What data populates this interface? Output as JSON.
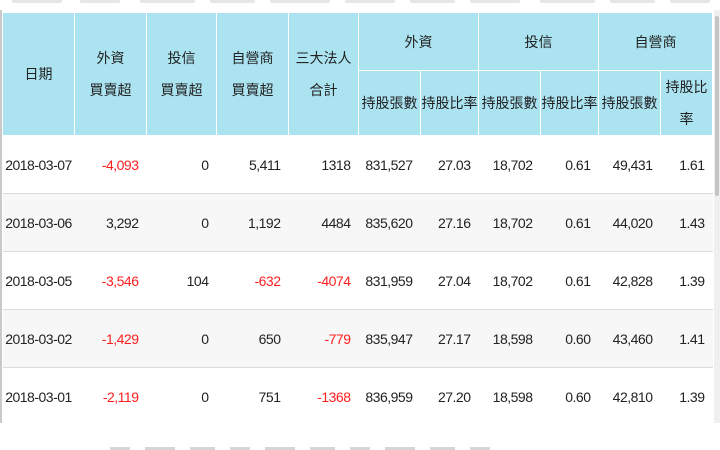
{
  "table": {
    "headers": {
      "date": "日期",
      "foreign_net_l1": "外資",
      "foreign_net_l2": "買賣超",
      "trust_net_l1": "投信",
      "trust_net_l2": "買賣超",
      "dealer_net_l1": "自營商",
      "dealer_net_l2": "買賣超",
      "total_l1": "三大法人",
      "total_l2": "合計",
      "foreign_group": "外資",
      "trust_group": "投信",
      "dealer_group": "自營商",
      "shares_held": "持股張數",
      "holding_ratio": "持股比率"
    },
    "rows": [
      {
        "date": "2018-03-07",
        "foreign_net": "-4,093",
        "trust_net": "0",
        "dealer_net": "5,411",
        "total": "1318",
        "f_shares": "831,527",
        "f_ratio": "27.03",
        "t_shares": "18,702",
        "t_ratio": "0.61",
        "d_shares": "49,431",
        "d_ratio": "1.61"
      },
      {
        "date": "2018-03-06",
        "foreign_net": "3,292",
        "trust_net": "0",
        "dealer_net": "1,192",
        "total": "4484",
        "f_shares": "835,620",
        "f_ratio": "27.16",
        "t_shares": "18,702",
        "t_ratio": "0.61",
        "d_shares": "44,020",
        "d_ratio": "1.43"
      },
      {
        "date": "2018-03-05",
        "foreign_net": "-3,546",
        "trust_net": "104",
        "dealer_net": "-632",
        "total": "-4074",
        "f_shares": "831,959",
        "f_ratio": "27.04",
        "t_shares": "18,702",
        "t_ratio": "0.61",
        "d_shares": "42,828",
        "d_ratio": "1.39"
      },
      {
        "date": "2018-03-02",
        "foreign_net": "-1,429",
        "trust_net": "0",
        "dealer_net": "650",
        "total": "-779",
        "f_shares": "835,947",
        "f_ratio": "27.17",
        "t_shares": "18,598",
        "t_ratio": "0.60",
        "d_shares": "43,460",
        "d_ratio": "1.41"
      },
      {
        "date": "2018-03-01",
        "foreign_net": "-2,119",
        "trust_net": "0",
        "dealer_net": "751",
        "total": "-1368",
        "f_shares": "836,959",
        "f_ratio": "27.20",
        "t_shares": "18,598",
        "t_ratio": "0.60",
        "d_shares": "42,810",
        "d_ratio": "1.39"
      }
    ]
  },
  "colors": {
    "header_bg": "#abe3f1",
    "negative_text": "#ff1f1f",
    "row_alt_bg": "#f7f7f7"
  }
}
